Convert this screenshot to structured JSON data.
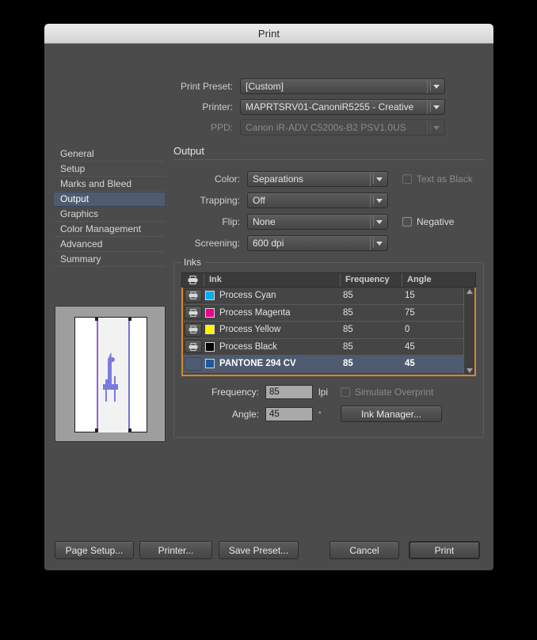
{
  "window": {
    "title": "Print"
  },
  "top_fields": [
    {
      "label": "Print Preset:",
      "value": "[Custom]",
      "disabled": false
    },
    {
      "label": "Printer:",
      "value": "MAPRTSRV01-CanoniR5255 - Creative",
      "disabled": false
    },
    {
      "label": "PPD:",
      "value": "Canon iR-ADV C5200s-B2 PSV1.0US",
      "disabled": true
    }
  ],
  "sidebar": {
    "items": [
      {
        "label": "General",
        "active": false
      },
      {
        "label": "Setup",
        "active": false
      },
      {
        "label": "Marks and Bleed",
        "active": false
      },
      {
        "label": "Output",
        "active": true
      },
      {
        "label": "Graphics",
        "active": false
      },
      {
        "label": "Color Management",
        "active": false
      },
      {
        "label": "Advanced",
        "active": false
      },
      {
        "label": "Summary",
        "active": false
      }
    ]
  },
  "panel": {
    "heading": "Output",
    "fields": [
      {
        "label": "Color:",
        "value": "Separations"
      },
      {
        "label": "Trapping:",
        "value": "Off"
      },
      {
        "label": "Flip:",
        "value": "None"
      },
      {
        "label": "Screening:",
        "value": "600 dpi"
      }
    ],
    "text_as_black": {
      "label": "Text as Black",
      "checked": false,
      "disabled": true
    },
    "negative": {
      "label": "Negative",
      "checked": false,
      "disabled": false
    }
  },
  "inks": {
    "legend": "Inks",
    "columns": [
      "Ink",
      "Frequency",
      "Angle"
    ],
    "print_column_icon": "printer-icon",
    "rows": [
      {
        "ink": "Process Cyan",
        "frequency": "85",
        "angle": "15",
        "swatch": "#00aeef",
        "printing": true,
        "selected": false
      },
      {
        "ink": "Process Magenta",
        "frequency": "85",
        "angle": "75",
        "swatch": "#ec008c",
        "printing": true,
        "selected": false
      },
      {
        "ink": "Process Yellow",
        "frequency": "85",
        "angle": "0",
        "swatch": "#fff200",
        "printing": true,
        "selected": false
      },
      {
        "ink": "Process Black",
        "frequency": "85",
        "angle": "45",
        "swatch": "#000000",
        "printing": true,
        "selected": false
      },
      {
        "ink": "PANTONE 294 CV",
        "frequency": "85",
        "angle": "45",
        "swatch": "#1a5a9b",
        "printing": false,
        "selected": true
      }
    ],
    "frequency": {
      "label": "Frequency:",
      "value": "85",
      "unit": "lpi"
    },
    "angle": {
      "label": "Angle:",
      "value": "45",
      "unit": "°"
    },
    "simulate_overprint": {
      "label": "Simulate Overprint",
      "checked": false,
      "disabled": true
    },
    "ink_manager_button": "Ink Manager..."
  },
  "footer": {
    "page_setup": "Page Setup...",
    "printer": "Printer...",
    "save_preset": "Save Preset...",
    "cancel": "Cancel",
    "print": "Print"
  },
  "colors": {
    "selection": "#4e5b70",
    "focus_ring": "#d4882c",
    "window_bg": "#4b4b4b",
    "artwork": "#7b7bdd",
    "page_guide": "#9d63d6"
  }
}
